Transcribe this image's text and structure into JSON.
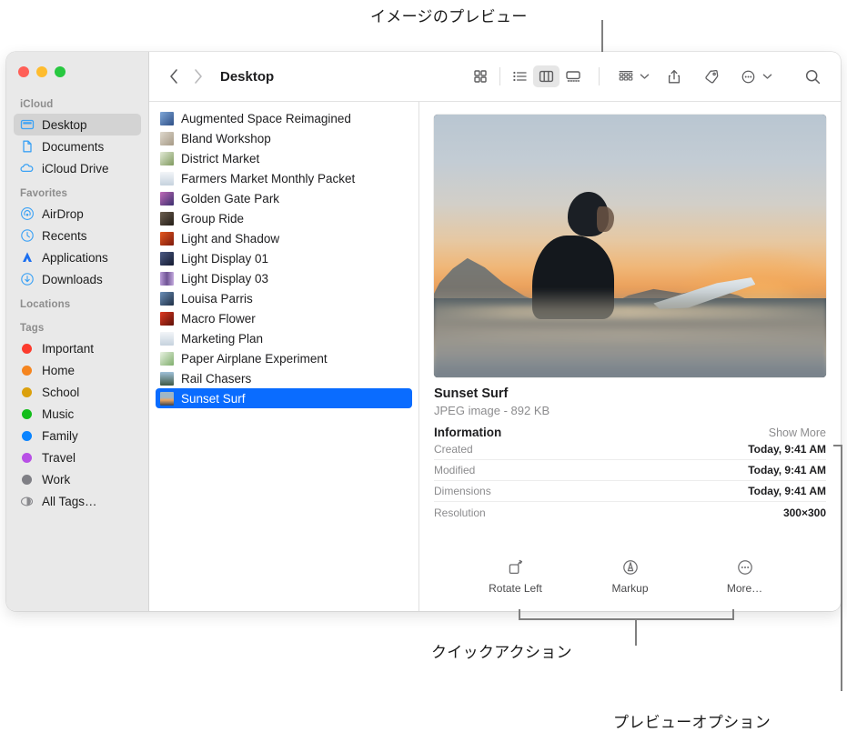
{
  "annotations": [
    {
      "id": "preview-image",
      "text": "イメージのプレビュー"
    },
    {
      "id": "quick-actions",
      "text": "クイックアクション"
    },
    {
      "id": "preview-options",
      "text": "プレビューオプション"
    }
  ],
  "window": {
    "traffic_lights": [
      {
        "name": "close",
        "color": "#ff5f57"
      },
      {
        "name": "minimize",
        "color": "#febc2e"
      },
      {
        "name": "zoom",
        "color": "#28c840"
      }
    ]
  },
  "sidebar": {
    "sections": [
      {
        "title": "iCloud",
        "items": [
          {
            "label": "Desktop",
            "icon": "desktop-icon",
            "selected": true
          },
          {
            "label": "Documents",
            "icon": "document-icon",
            "selected": false
          },
          {
            "label": "iCloud Drive",
            "icon": "cloud-icon",
            "selected": false
          }
        ]
      },
      {
        "title": "Favorites",
        "items": [
          {
            "label": "AirDrop",
            "icon": "airdrop-icon",
            "selected": false
          },
          {
            "label": "Recents",
            "icon": "clock-icon",
            "selected": false
          },
          {
            "label": "Applications",
            "icon": "applications-icon",
            "selected": false
          },
          {
            "label": "Downloads",
            "icon": "downloads-icon",
            "selected": false
          }
        ]
      },
      {
        "title": "Locations",
        "items": []
      },
      {
        "title": "Tags",
        "items": [
          {
            "label": "Important",
            "icon": "tag-dot",
            "color": "#fc3b2d",
            "selected": false
          },
          {
            "label": "Home",
            "icon": "tag-dot",
            "color": "#f5851f",
            "selected": false
          },
          {
            "label": "School",
            "icon": "tag-dot",
            "color": "#dba00c",
            "selected": false
          },
          {
            "label": "Music",
            "icon": "tag-dot",
            "color": "#13bd1b",
            "selected": false
          },
          {
            "label": "Family",
            "icon": "tag-dot",
            "color": "#0a84ff",
            "selected": false
          },
          {
            "label": "Travel",
            "icon": "tag-dot",
            "color": "#b850e6",
            "selected": false
          },
          {
            "label": "Work",
            "icon": "tag-dot",
            "color": "#7f7f85",
            "selected": false
          },
          {
            "label": "All Tags…",
            "icon": "all-tags-icon",
            "selected": false
          }
        ]
      }
    ]
  },
  "toolbar": {
    "back_label": "‹",
    "forward_label": "›",
    "title": "Desktop",
    "views": [
      {
        "name": "icon-view",
        "active": false
      },
      {
        "name": "list-view",
        "active": false
      },
      {
        "name": "column-view",
        "active": true
      },
      {
        "name": "gallery-view",
        "active": false
      }
    ],
    "buttons": [
      {
        "name": "group-by-button",
        "has_chevron": true
      },
      {
        "name": "share-button",
        "has_chevron": false
      },
      {
        "name": "tag-button",
        "has_chevron": false
      },
      {
        "name": "more-button",
        "has_chevron": true
      },
      {
        "name": "search-button",
        "has_chevron": false
      }
    ]
  },
  "filelist": {
    "items": [
      {
        "name": "Augmented Space Reimagined",
        "thumb": "#5a7fb5",
        "selected": false
      },
      {
        "name": "Bland Workshop",
        "thumb": "#c9c2b6",
        "selected": false
      },
      {
        "name": "District Market",
        "thumb": "#b7c8a4",
        "selected": false
      },
      {
        "name": "Farmers Market Monthly Packet",
        "thumb": "#dfe4ea",
        "selected": false
      },
      {
        "name": "Golden Gate Park",
        "thumb": "#8a4f8c",
        "selected": false
      },
      {
        "name": "Group Ride",
        "thumb": "#4a4035",
        "selected": false
      },
      {
        "name": "Light and Shadow",
        "thumb": "#c5401f",
        "selected": false
      },
      {
        "name": "Light Display 01",
        "thumb": "#2b3350",
        "selected": false
      },
      {
        "name": "Light Display 03",
        "thumb": "#8e6fb0",
        "selected": false
      },
      {
        "name": "Louisa Parris",
        "thumb": "#3e5f86",
        "selected": false
      },
      {
        "name": "Macro Flower",
        "thumb": "#b02a1e",
        "selected": false
      },
      {
        "name": "Marketing Plan",
        "thumb": "#dfe4ea",
        "selected": false
      },
      {
        "name": "Paper Airplane Experiment",
        "thumb": "#cfe2c4",
        "selected": false
      },
      {
        "name": "Rail Chasers",
        "thumb": "#6f8ba0",
        "selected": false
      },
      {
        "name": "Sunset Surf",
        "thumb": "#d9915a",
        "selected": true
      }
    ]
  },
  "preview": {
    "image_alt": "Sunset Surf",
    "title": "Sunset Surf",
    "subtitle": "JPEG image - 892 KB",
    "information_label": "Information",
    "show_more_label": "Show More",
    "rows": [
      {
        "key": "Created",
        "value": "Today, 9:41 AM"
      },
      {
        "key": "Modified",
        "value": "Today, 9:41 AM"
      },
      {
        "key": "Dimensions",
        "value": "Today, 9:41 AM"
      },
      {
        "key": "Resolution",
        "value": "300×300"
      }
    ],
    "quick_actions": [
      {
        "label": "Rotate Left",
        "icon": "rotate-left-icon"
      },
      {
        "label": "Markup",
        "icon": "markup-icon"
      },
      {
        "label": "More…",
        "icon": "more-circle-icon"
      }
    ]
  },
  "colors": {
    "selection_blue": "#0a6cff",
    "sidebar_bg": "#e9e9e9",
    "window_bg": "#ffffff"
  }
}
